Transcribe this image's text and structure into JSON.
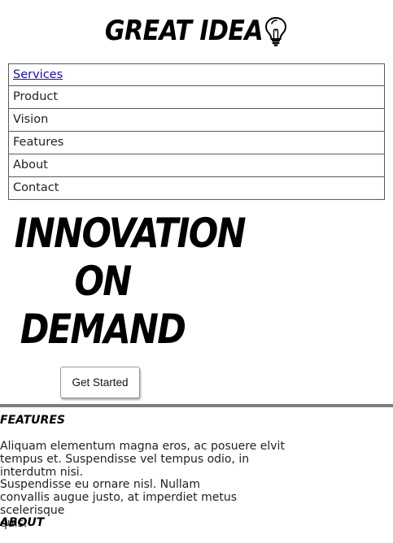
{
  "brand": {
    "name": "GREAT IDEA",
    "icon": "lightbulb-icon"
  },
  "nav": {
    "items": [
      {
        "label": "Services",
        "active": true
      },
      {
        "label": "Product"
      },
      {
        "label": "Vision"
      },
      {
        "label": "Features"
      },
      {
        "label": "About"
      },
      {
        "label": "Contact"
      }
    ]
  },
  "hero": {
    "title_lines": [
      "INNOVATION",
      "ON",
      "DEMAND"
    ],
    "cta_label": "Get Started"
  },
  "features": {
    "heading": "FEATURES",
    "text_lines": [
      "Aliquam elementum magna eros, ac posuere elvit",
      "tempus et. Suspendisse vel tempus odio, in",
      "interdutm nisi.",
      "Suspendisse eu ornare nisl. Nullam",
      "convallis augue justo, at imperdiet metus scelerisque",
      "quis."
    ]
  },
  "about": {
    "heading": "ABOUT"
  },
  "colors": {
    "link": "#1a0dab",
    "nav_border": "#5a5a5a",
    "divider": "#7d7d7d",
    "text": "#222222"
  }
}
